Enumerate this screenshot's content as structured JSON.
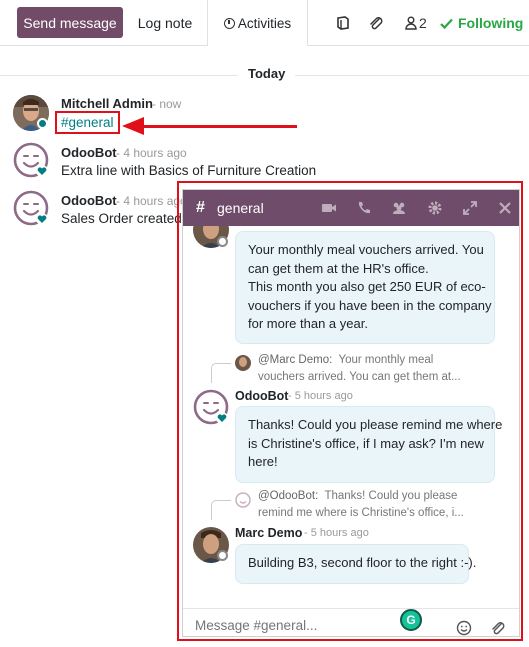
{
  "toolbar": {
    "send_message": "Send message",
    "log_note": "Log note",
    "activities": "Activities",
    "followers_count": "2",
    "following": "Following"
  },
  "thread": {
    "separator": "Today",
    "messages": [
      {
        "author": "Mitchell Admin",
        "date": "- now",
        "body": "#general"
      },
      {
        "author": "OdooBot",
        "date": "- 4 hours ago",
        "body": "Extra line with Basics of Furniture Creation"
      },
      {
        "author": "OdooBot",
        "date": "- 4 hours ago",
        "body": "Sales Order created"
      }
    ]
  },
  "chat": {
    "hash": "#",
    "title": "general",
    "messages": [
      {
        "lines": [
          "Your monthly meal vouchers arrived. You",
          "can get them at the HR's office.",
          "This month you also get 250 EUR of eco-",
          "vouchers if you have been in the company",
          "for more than a year."
        ]
      },
      {
        "reply_author": "@Marc Demo:",
        "reply_line1": "Your monthly meal",
        "reply_line2": "vouchers arrived. You can get them at...",
        "author": "OdooBot",
        "date": "- 5 hours ago",
        "lines": [
          "Thanks! Could you please remind me where",
          "is Christine's office, if I may ask? I'm new",
          "here!"
        ]
      },
      {
        "reply_author": "@OdooBot:",
        "reply_line1": "Thanks! Could you please",
        "reply_line2": "remind me where is Christine's office, i...",
        "author": "Marc Demo",
        "date": "- 5 hours ago",
        "lines": [
          "Building B3, second floor to the right :-)."
        ]
      }
    ],
    "composer_placeholder": "Message #general...",
    "grammarly_label": "G"
  },
  "colors": {
    "brand": "#714b67",
    "chat_header": "#6f4c6a",
    "following": "#28a745",
    "link": "#017e84",
    "annotation": "#e0101a",
    "bubble": "#eaf5f9"
  }
}
